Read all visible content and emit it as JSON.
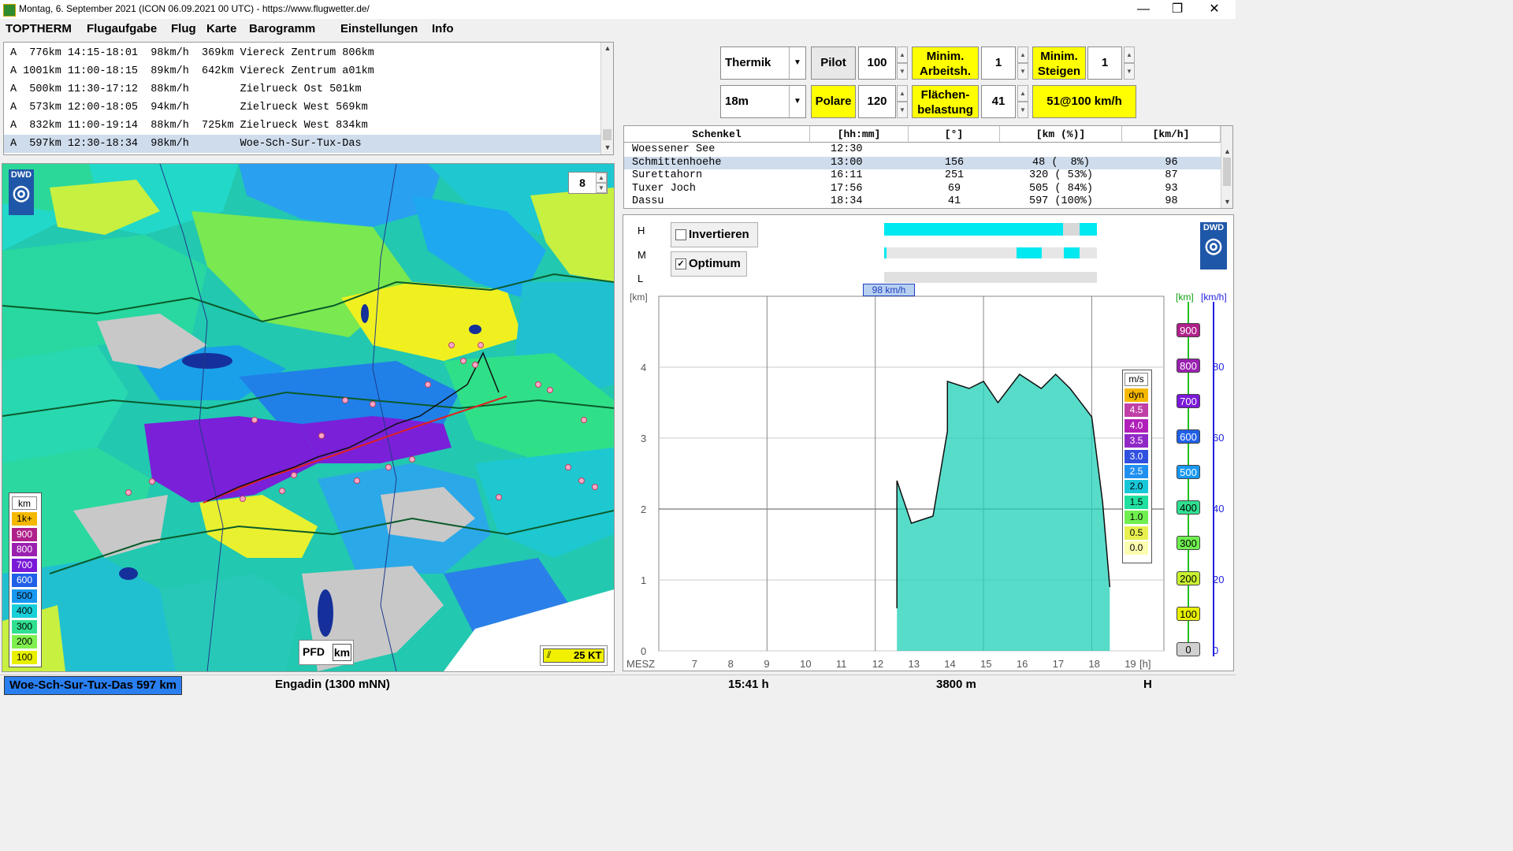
{
  "window": {
    "title": "Montag, 6. September 2021 (ICON 06.09.2021 00 UTC) - https://www.flugwetter.de/",
    "minimize": "—",
    "maximize": "❐",
    "close": "✕"
  },
  "menu": [
    "TOPTHERM",
    "Flugaufgabe",
    "Flug",
    "Karte",
    "Barogramm",
    "Einstellungen",
    "Info"
  ],
  "tasks": [
    "A  776km 14:15-18:01  98km/h  369km Viereck Zentrum 806km",
    "A 1001km 11:00-18:15  89km/h  642km Viereck Zentrum a01km",
    "A  500km 11:30-17:12  88km/h        Zielrueck Ost 501km",
    "A  573km 12:00-18:05  94km/h        Zielrueck West 569km",
    "A  832km 11:00-19:14  88km/h  725km Zielrueck West 834km",
    "A  597km 12:30-18:34  98km/h        Woe-Sch-Sur-Tux-Das"
  ],
  "tasks_selected_index": 5,
  "map": {
    "logo": "DWD",
    "zoom": "8",
    "legend_title": "km",
    "legend": [
      {
        "label": "1k+",
        "color": "#f5b800"
      },
      {
        "label": "900",
        "color": "#b0208a"
      },
      {
        "label": "800",
        "color": "#9a20b0"
      },
      {
        "label": "700",
        "color": "#7a18d8"
      },
      {
        "label": "600",
        "color": "#2060e8"
      },
      {
        "label": "500",
        "color": "#1898f0"
      },
      {
        "label": "400",
        "color": "#18d0d8"
      },
      {
        "label": "300",
        "color": "#30e090"
      },
      {
        "label": "200",
        "color": "#80f050"
      },
      {
        "label": "100",
        "color": "#e8f000"
      }
    ],
    "pfd": "PFD",
    "km": "km",
    "wind": "25 KT"
  },
  "controls": {
    "mode_select": "Thermik",
    "pilot_label": "Pilot",
    "pilot_value": "100",
    "min_arbeit_label": "Minim. Arbeitsh.",
    "min_arbeit_value": "1",
    "min_steigen_label": "Minim. Steigen",
    "min_steigen_value": "1",
    "span_select": "18m",
    "polare_label": "Polare",
    "polare_value": "120",
    "flaechen_label": "Flächen- belastung",
    "flaechen_value": "41",
    "result": "51@100 km/h"
  },
  "legs": {
    "headers": [
      "Schenkel",
      "[hh:mm]",
      "[°]",
      "[km (%)]",
      "[km/h]"
    ],
    "rows": [
      {
        "name": "Woessener See",
        "time": "12:30",
        "deg": "",
        "km": "",
        "kmh": ""
      },
      {
        "name": "Schmittenhoehe",
        "time": "13:00",
        "deg": "156",
        "km": "48 (  8%)",
        "kmh": "96"
      },
      {
        "name": "Surettahorn",
        "time": "16:11",
        "deg": "251",
        "km": "320 ( 53%)",
        "kmh": "87"
      },
      {
        "name": "Tuxer Joch",
        "time": "17:56",
        "deg": "69",
        "km": "505 ( 84%)",
        "kmh": "93"
      },
      {
        "name": "Dassu",
        "time": "18:34",
        "deg": "41",
        "km": "597 (100%)",
        "kmh": "98"
      }
    ],
    "selected_index": 1
  },
  "baro": {
    "invertieren": "Invertieren",
    "optimum": "Optimum",
    "invertieren_checked": false,
    "optimum_checked": true,
    "cloud_labels": [
      "H",
      "M",
      "L"
    ],
    "logo": "DWD",
    "unit_left": "[km]",
    "unit_km": "[km]",
    "unit_kmh": "[km/h]",
    "speed_badge": "98 km/h",
    "x_axis_label": "MESZ",
    "x_unit": "[h]",
    "ms_title": "m/s",
    "ms_scale": [
      {
        "label": "dyn",
        "color": "#f5b800"
      },
      {
        "label": "4.5",
        "color": "#c040a8"
      },
      {
        "label": "4.0",
        "color": "#b020b8"
      },
      {
        "label": "3.5",
        "color": "#9028c8"
      },
      {
        "label": "3.0",
        "color": "#3050e0"
      },
      {
        "label": "2.5",
        "color": "#2090f0"
      },
      {
        "label": "2.0",
        "color": "#18c8d8"
      },
      {
        "label": "1.5",
        "color": "#20e0a0"
      },
      {
        "label": "1.0",
        "color": "#70f050"
      },
      {
        "label": "0.5",
        "color": "#e8f050"
      },
      {
        "label": "0.0",
        "color": "#fcfcb0"
      }
    ],
    "km_scale": [
      {
        "label": "900",
        "color": "#b0208a"
      },
      {
        "label": "800",
        "color": "#9a20b0"
      },
      {
        "label": "700",
        "color": "#7a18d8"
      },
      {
        "label": "600",
        "color": "#2060e8"
      },
      {
        "label": "500",
        "color": "#1898f0"
      },
      {
        "label": "400",
        "color": "#30e090"
      },
      {
        "label": "300",
        "color": "#70f050"
      },
      {
        "label": "200",
        "color": "#c8f030"
      },
      {
        "label": "100",
        "color": "#e8f000"
      },
      {
        "label": "0",
        "color": "#d0d0d0"
      }
    ],
    "kmh_ticks": [
      "80",
      "60",
      "40",
      "20",
      "0"
    ]
  },
  "chart_data": {
    "type": "area",
    "xlabel": "MESZ",
    "x_unit": "[h]",
    "ylabel": "[km]",
    "x_ticks": [
      "7",
      "8",
      "9",
      "10",
      "11",
      "12",
      "13",
      "14",
      "15",
      "16",
      "17",
      "18",
      "19"
    ],
    "y_ticks": [
      "0",
      "1",
      "2",
      "3",
      "4"
    ],
    "xlim": [
      6,
      20
    ],
    "ylim": [
      0,
      5
    ],
    "series": [
      {
        "name": "",
        "x": [
          12.6,
          12.6,
          13.0,
          13.6,
          14.0,
          14.0,
          14.6,
          15.0,
          15.4,
          16.0,
          16.6,
          17.0,
          17.4,
          18.0,
          18.3,
          18.5
        ],
        "y": [
          0.6,
          2.4,
          1.8,
          1.9,
          3.1,
          3.8,
          3.7,
          3.8,
          3.5,
          3.9,
          3.7,
          3.9,
          3.7,
          3.3,
          2.1,
          0.9
        ]
      }
    ]
  },
  "status": {
    "task": "Woe-Sch-Sur-Tux-Das 597 km",
    "region": "Engadin (1300 mNN)",
    "time": "15:41 h",
    "height": "3800 m",
    "mode": "H"
  }
}
